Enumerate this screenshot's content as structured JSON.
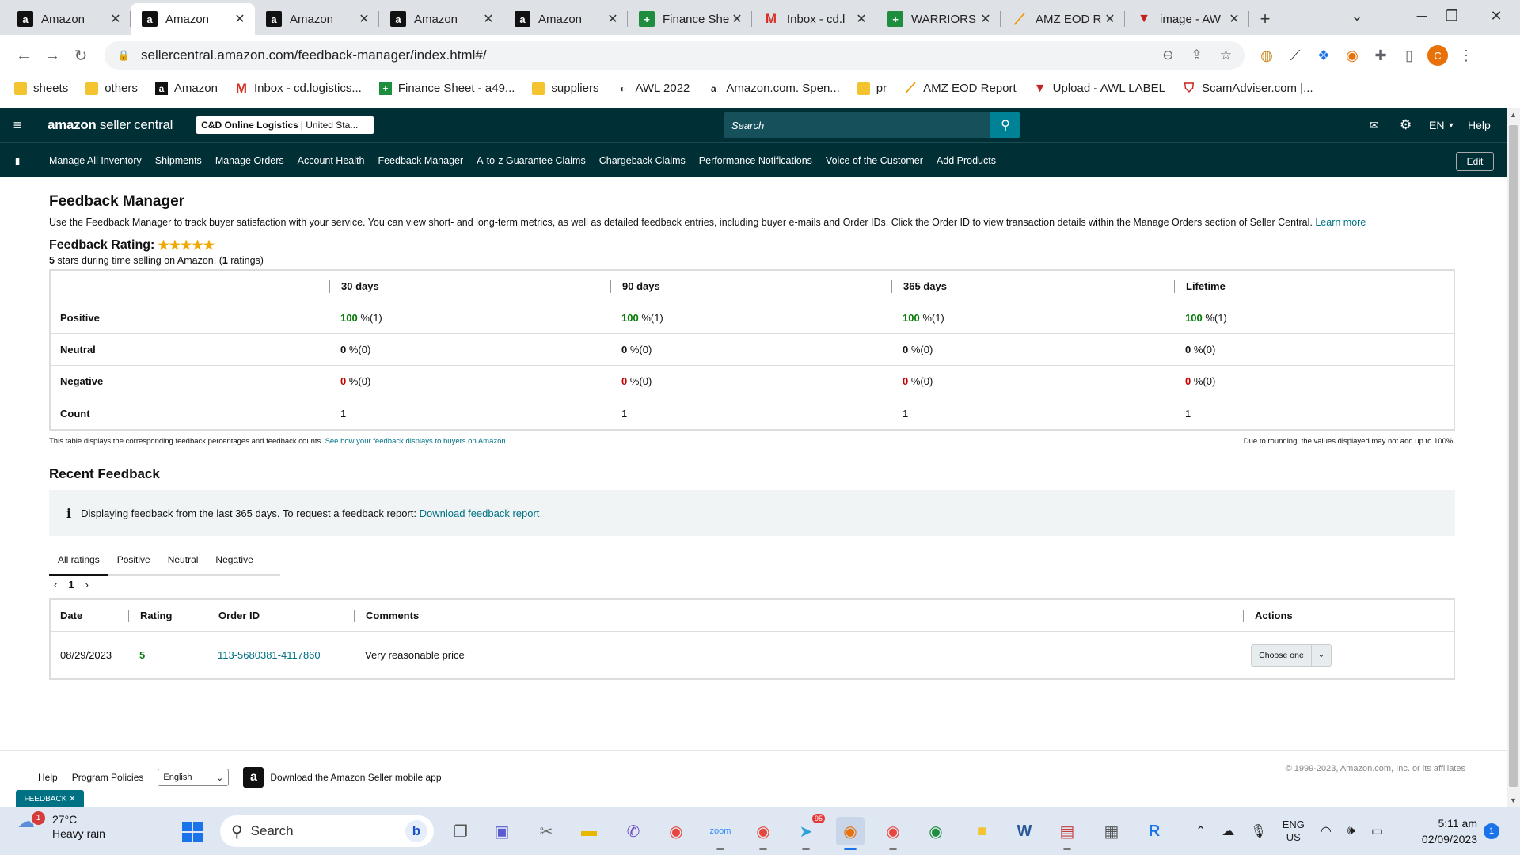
{
  "browser": {
    "tabs": [
      {
        "title": "Amazon",
        "favicon": "amazon-icon"
      },
      {
        "title": "Amazon",
        "favicon": "amazon-icon",
        "active": true
      },
      {
        "title": "Amazon",
        "favicon": "amazon-icon"
      },
      {
        "title": "Amazon",
        "favicon": "amazon-icon"
      },
      {
        "title": "Amazon",
        "favicon": "amazon-icon"
      },
      {
        "title": "Finance She",
        "favicon": "sheets-icon"
      },
      {
        "title": "Inbox - cd.l",
        "favicon": "gmail-icon"
      },
      {
        "title": "WARRIORS",
        "favicon": "sheets-icon"
      },
      {
        "title": "AMZ EOD R",
        "favicon": "amz-eod-icon"
      },
      {
        "title": "image - AW",
        "favicon": "awl-icon"
      }
    ],
    "new_tab": "+",
    "url": "sellercentral.amazon.com/feedback-manager/index.html#/",
    "profile_initial": "C",
    "bookmarks": [
      {
        "label": "sheets",
        "icon": "folder-icon"
      },
      {
        "label": "others",
        "icon": "folder-icon"
      },
      {
        "label": "Amazon",
        "icon": "amazon-icon"
      },
      {
        "label": "Inbox - cd.logistics...",
        "icon": "gmail-icon"
      },
      {
        "label": "Finance Sheet - a49...",
        "icon": "sheets-icon"
      },
      {
        "label": "suppliers",
        "icon": "folder-icon"
      },
      {
        "label": "AWL 2022",
        "icon": "globe-icon"
      },
      {
        "label": "Amazon.com. Spen...",
        "icon": "amazon-a-icon"
      },
      {
        "label": "pr",
        "icon": "folder-icon"
      },
      {
        "label": "AMZ EOD Report",
        "icon": "amz-eod-icon"
      },
      {
        "label": "Upload - AWL LABEL",
        "icon": "awl-icon"
      },
      {
        "label": "ScamAdviser.com |...",
        "icon": "shield-icon"
      }
    ]
  },
  "header": {
    "logo_main": "amazon",
    "logo_sub": " seller central",
    "account_bold": "C&D Online Logistics",
    "account_rest": " | United Sta...",
    "search_placeholder": "Search",
    "language": "EN",
    "help": "Help"
  },
  "nav": {
    "items": [
      "Manage All Inventory",
      "Shipments",
      "Manage Orders",
      "Account Health",
      "Feedback Manager",
      "A-to-z Guarantee Claims",
      "Chargeback Claims",
      "Performance Notifications",
      "Voice of the Customer",
      "Add Products"
    ],
    "edit": "Edit"
  },
  "page": {
    "title": "Feedback Manager",
    "description": "Use the Feedback Manager to track buyer satisfaction with your service. You can view short- and long-term metrics, as well as detailed feedback entries, including buyer e-mails and Order IDs. Click the Order ID to view transaction details within the Manage Orders section of Seller Central.",
    "learn_more": "Learn more",
    "rating_label": "Feedback Rating:",
    "rating_stars": 5,
    "rating_summary_stars": "5",
    "rating_summary_mid": " stars during time selling on Amazon. (",
    "rating_summary_count": "1",
    "rating_summary_end": " ratings)"
  },
  "ratings_table": {
    "columns": [
      "30 days",
      "90 days",
      "365 days",
      "Lifetime"
    ],
    "rows": [
      {
        "label": "Positive",
        "cells": [
          {
            "v": "100",
            "s": " %(1)"
          },
          {
            "v": "100",
            "s": " %(1)"
          },
          {
            "v": "100",
            "s": " %(1)"
          },
          {
            "v": "100",
            "s": " %(1)"
          }
        ]
      },
      {
        "label": "Neutral",
        "cells": [
          {
            "v": "0",
            "s": " %(0)"
          },
          {
            "v": "0",
            "s": " %(0)"
          },
          {
            "v": "0",
            "s": " %(0)"
          },
          {
            "v": "0",
            "s": " %(0)"
          }
        ]
      },
      {
        "label": "Negative",
        "cells": [
          {
            "v": "0",
            "s": " %(0)"
          },
          {
            "v": "0",
            "s": " %(0)"
          },
          {
            "v": "0",
            "s": " %(0)"
          },
          {
            "v": "0",
            "s": " %(0)"
          }
        ]
      },
      {
        "label": "Count",
        "cells": [
          {
            "v": "1",
            "s": ""
          },
          {
            "v": "1",
            "s": ""
          },
          {
            "v": "1",
            "s": ""
          },
          {
            "v": "1",
            "s": ""
          }
        ]
      }
    ],
    "footnote": "This table displays the corresponding feedback percentages and feedback counts.",
    "footnote_link": "See how your feedback displays to buyers on Amazon.",
    "rounding_note": "Due to rounding, the values displayed may not add up to 100%."
  },
  "recent": {
    "title": "Recent Feedback",
    "info_text": "Displaying feedback from the last 365 days. To request a feedback report:",
    "info_link": "Download feedback report",
    "tabs": [
      "All ratings",
      "Positive",
      "Neutral",
      "Negative"
    ],
    "page": "1",
    "columns": [
      "Date",
      "Rating",
      "Order ID",
      "Comments",
      "Actions"
    ],
    "rows": [
      {
        "date": "08/29/2023",
        "rating": "5",
        "order_id": "113-5680381-4117860",
        "comment": "Very reasonable price",
        "action": "Choose one"
      }
    ]
  },
  "footer": {
    "help": "Help",
    "policies": "Program Policies",
    "language": "English",
    "app_text": "Download the Amazon Seller mobile app",
    "copyright": "© 1999-2023, Amazon.com, Inc. or its affiliates",
    "feedback_tab": "FEEDBACK ✕"
  },
  "taskbar": {
    "weather_temp": "27°C",
    "weather_desc": "Heavy rain",
    "weather_badge": "1",
    "search": "Search",
    "telegram_badge": "95",
    "lang1": "ENG",
    "lang2": "US",
    "time": "5:11 am",
    "date": "02/09/2023",
    "notifications": "1"
  }
}
